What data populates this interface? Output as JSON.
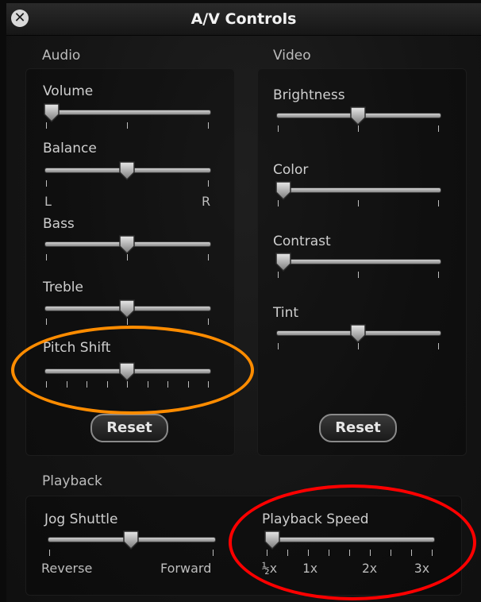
{
  "window": {
    "title": "A/V Controls"
  },
  "audio": {
    "section_label": "Audio",
    "volume": {
      "label": "Volume",
      "level": 0
    },
    "balance": {
      "label": "Balance",
      "left_label": "L",
      "right_label": "R",
      "level": 0.5
    },
    "bass": {
      "label": "Bass",
      "level": 0.5
    },
    "treble": {
      "label": "Treble",
      "level": 0.5
    },
    "pitch_shift": {
      "label": "Pitch Shift",
      "level": 0.5
    },
    "reset_label": "Reset"
  },
  "video": {
    "section_label": "Video",
    "brightness": {
      "label": "Brightness",
      "level": 0.5
    },
    "color": {
      "label": "Color",
      "level": 0
    },
    "contrast": {
      "label": "Contrast",
      "level": 0
    },
    "tint": {
      "label": "Tint",
      "level": 0.5
    },
    "reset_label": "Reset"
  },
  "playback": {
    "section_label": "Playback",
    "jog_shuttle": {
      "label": "Jog Shuttle",
      "left_label": "Reverse",
      "right_label": "Forward",
      "level": 0.5
    },
    "playback_speed": {
      "label": "Playback Speed",
      "tick_labels": [
        "½x",
        "1x",
        "2x",
        "3x"
      ],
      "level": 0
    }
  },
  "annotations": {
    "pitch_shift_highlight_color": "#ff8c00",
    "playback_speed_highlight_color": "#ff0000"
  },
  "icons": {
    "close": "close-icon"
  }
}
